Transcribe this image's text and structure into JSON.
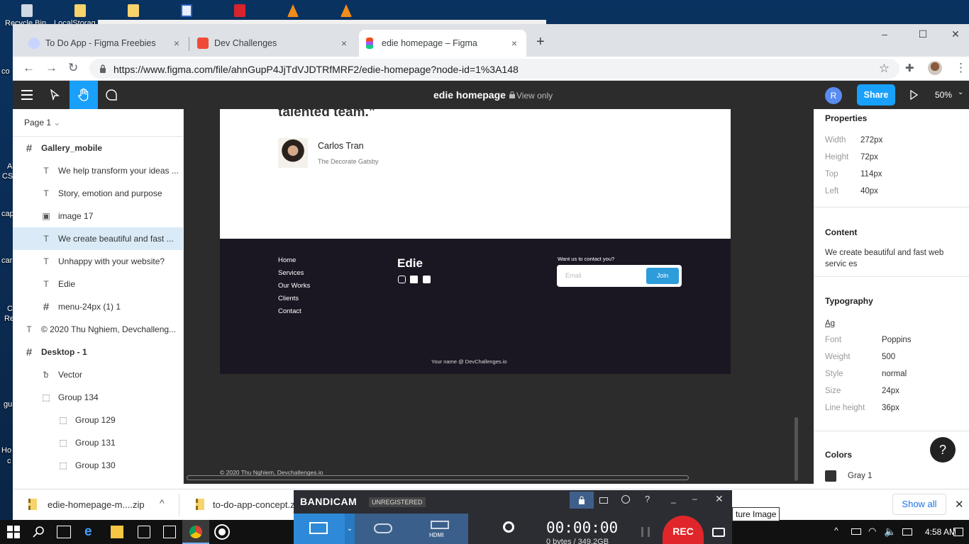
{
  "desktop": {
    "labels": [
      {
        "text": "Recycle Bin"
      },
      {
        "text": "LocalStorag"
      },
      {
        "text": "co"
      },
      {
        "text": "A"
      },
      {
        "text": "CS"
      },
      {
        "text": "cap"
      },
      {
        "text": "car"
      },
      {
        "text": "C"
      },
      {
        "text": "Re"
      },
      {
        "text": "gu"
      },
      {
        "text": "Ho"
      },
      {
        "text": "c"
      }
    ]
  },
  "browser": {
    "tabs": [
      {
        "title": "To Do App - Figma Freebies",
        "icon_color": "#c9d3ff",
        "close": "×"
      },
      {
        "title": "Dev Challenges",
        "icon_color": "#f04b37",
        "close": "×"
      },
      {
        "title": "edie homepage – Figma",
        "icon_color": "#f24e1e",
        "close": "×"
      }
    ],
    "new_tab": "+",
    "window_controls": {
      "minimize": "–",
      "maximize": "☐",
      "close": "✕"
    },
    "url": "https://www.figma.com/file/ahnGupP4JjTdVJDTRfMRF2/edie-homepage?node-id=1%3A148",
    "nav": {
      "back": "←",
      "forward": "→",
      "reload": "↻"
    },
    "star": "☆",
    "extensions": "✚",
    "menu": "⋮"
  },
  "figma": {
    "file_title": "edie homepage",
    "view_mode": "View only",
    "avatar_initial": "R",
    "share_label": "Share",
    "zoom": "50%",
    "page_label": "Page 1",
    "layers": [
      {
        "name": "Gallery_mobile",
        "icon": "#",
        "indent": 0,
        "bold": true
      },
      {
        "name": "We help transform your ideas ...",
        "icon": "T",
        "indent": 1
      },
      {
        "name": "Story, emotion and purpose",
        "icon": "T",
        "indent": 1
      },
      {
        "name": "image 17",
        "icon": "▣",
        "indent": 1
      },
      {
        "name": "We create beautiful and fast ...",
        "icon": "T",
        "indent": 1,
        "selected": true
      },
      {
        "name": "Unhappy with your website?",
        "icon": "T",
        "indent": 1
      },
      {
        "name": "Edie",
        "icon": "T",
        "indent": 1
      },
      {
        "name": "menu-24px (1) 1",
        "icon": "#",
        "indent": 1
      },
      {
        "name": "© 2020 Thu Nghiem, Devchalleng...",
        "icon": "T",
        "indent": 0
      },
      {
        "name": "Desktop - 1",
        "icon": "#",
        "indent": 0,
        "bold": true
      },
      {
        "name": "Vector",
        "icon": "ᵬ",
        "indent": 1
      },
      {
        "name": "Group 134",
        "icon": "⬚",
        "indent": 1
      },
      {
        "name": "Group 129",
        "icon": "⬚",
        "indent": 2
      },
      {
        "name": "Group 131",
        "icon": "⬚",
        "indent": 2
      },
      {
        "name": "Group 130",
        "icon": "⬚",
        "indent": 2
      }
    ],
    "canvas": {
      "quote_tail": "talented team.”",
      "author_name": "Carlos Tran",
      "author_company": "The Decorate Gatsby",
      "footer_links": [
        "Home",
        "Services",
        "Our Works",
        "Clients",
        "Contact"
      ],
      "brand": "Edie",
      "contact_prompt": "Want us to contact you?",
      "email_placeholder": "Email",
      "join_label": "Join",
      "footer_credit": "Your name @ DevChallenges.io",
      "copyright": "© 2020 Thu Nghiem, Devchallenges.io"
    },
    "properties": {
      "title": "Properties",
      "fields": [
        {
          "label": "Width",
          "value": "272px"
        },
        {
          "label": "Height",
          "value": "72px"
        },
        {
          "label": "Top",
          "value": "114px"
        },
        {
          "label": "Left",
          "value": "40px"
        }
      ],
      "content_title": "Content",
      "content_text": "We create beautiful and fast web servic es",
      "typography_title": "Typography",
      "ag": "Ag",
      "typo": [
        {
          "label": "Font",
          "value": "Poppins"
        },
        {
          "label": "Weight",
          "value": "500"
        },
        {
          "label": "Style",
          "value": "normal"
        },
        {
          "label": "Size",
          "value": "24px"
        },
        {
          "label": "Line height",
          "value": "36px"
        }
      ],
      "colors_title": "Colors",
      "color_name": "Gray 1",
      "help": "?"
    }
  },
  "downloads": {
    "items": [
      {
        "name": "edie-homepage-m....zip"
      },
      {
        "name": "to-do-app-concept.z"
      }
    ],
    "show_all": "Show all",
    "close": "✕"
  },
  "bandicam": {
    "brand": "BANDICAM",
    "registered": "UNREGISTERED",
    "timer": "00:00:00",
    "size": "0 bytes / 349.2GB",
    "rec": "REC",
    "hdmi": "HDMI",
    "tooltip": "ture Image"
  },
  "taskbar": {
    "time": "4:58 AM"
  }
}
